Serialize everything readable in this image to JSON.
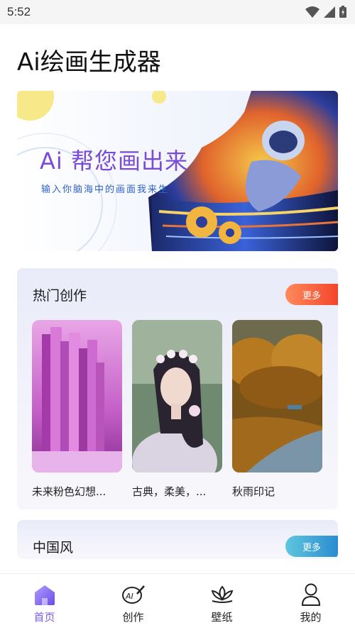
{
  "status_bar": {
    "time": "5:52"
  },
  "app": {
    "title": "Ai绘画生成器"
  },
  "banner": {
    "title": "Ai 帮您画出来",
    "subtitle": "输入你脑海中的画面我来生"
  },
  "hot_section": {
    "title": "热门创作",
    "more_label": "更多",
    "items": [
      {
        "caption": "未来粉色幻想..."
      },
      {
        "caption": "古典，柔美，..."
      },
      {
        "caption": "秋雨印记"
      }
    ]
  },
  "chinese_section": {
    "title": "中国风",
    "more_label": "更多"
  },
  "bottom_nav": {
    "items": [
      {
        "label": "首页",
        "icon": "home-icon",
        "active": true
      },
      {
        "label": "创作",
        "icon": "palette-icon"
      },
      {
        "label": "壁纸",
        "icon": "lotus-icon"
      },
      {
        "label": "我的",
        "icon": "person-icon"
      }
    ]
  },
  "colors": {
    "accent": "#7c5cf0",
    "more_hot": "#f2452b",
    "more_cn": "#2c8cd0",
    "banner_title": "#7a4ad8"
  }
}
